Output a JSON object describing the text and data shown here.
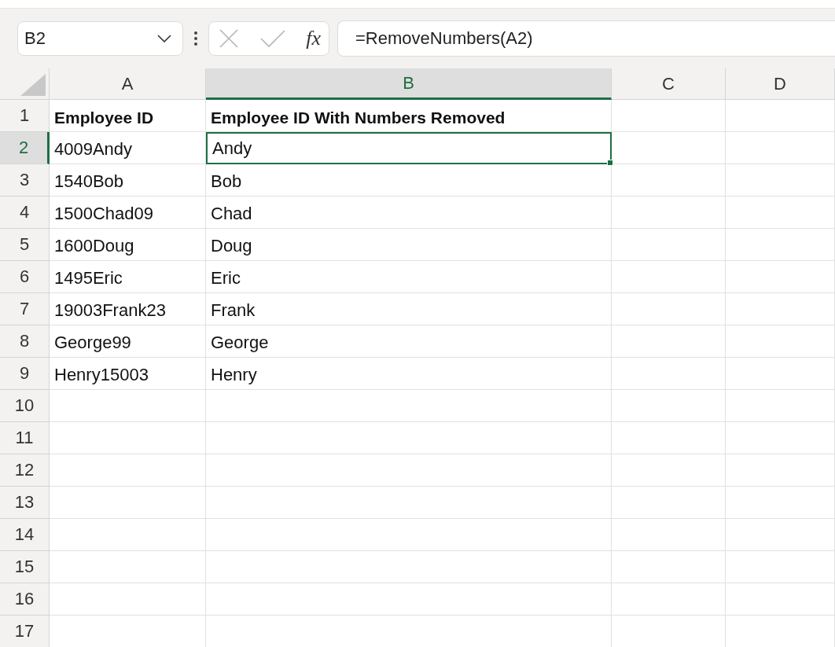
{
  "formula_bar": {
    "name_box": "B2",
    "function_label": "fx",
    "formula": "=RemoveNumbers(A2)"
  },
  "columns": [
    {
      "label": "A",
      "selected": false
    },
    {
      "label": "B",
      "selected": true
    },
    {
      "label": "C",
      "selected": false
    },
    {
      "label": "D",
      "selected": false
    }
  ],
  "rows": [
    {
      "number": "1",
      "selected": false,
      "kind": "header",
      "cells": [
        "Employee ID",
        "Employee ID With Numbers Removed"
      ]
    },
    {
      "number": "2",
      "selected": true,
      "kind": "data",
      "cells": [
        "4009Andy",
        "Andy"
      ]
    },
    {
      "number": "3",
      "selected": false,
      "kind": "data",
      "cells": [
        "1540Bob",
        "Bob"
      ]
    },
    {
      "number": "4",
      "selected": false,
      "kind": "data",
      "cells": [
        "1500Chad09",
        "Chad"
      ]
    },
    {
      "number": "5",
      "selected": false,
      "kind": "data",
      "cells": [
        "1600Doug",
        "Doug"
      ]
    },
    {
      "number": "6",
      "selected": false,
      "kind": "data",
      "cells": [
        "1495Eric",
        "Eric"
      ]
    },
    {
      "number": "7",
      "selected": false,
      "kind": "data",
      "cells": [
        "19003Frank23",
        "Frank"
      ]
    },
    {
      "number": "8",
      "selected": false,
      "kind": "data",
      "cells": [
        "George99",
        "George"
      ]
    },
    {
      "number": "9",
      "selected": false,
      "kind": "data",
      "cells": [
        "Henry15003",
        "Henry"
      ]
    },
    {
      "number": "10",
      "selected": false
    },
    {
      "number": "11",
      "selected": false
    },
    {
      "number": "12",
      "selected": false
    },
    {
      "number": "13",
      "selected": false
    },
    {
      "number": "14",
      "selected": false
    },
    {
      "number": "15",
      "selected": false
    },
    {
      "number": "16",
      "selected": false
    },
    {
      "number": "17",
      "selected": false
    }
  ]
}
